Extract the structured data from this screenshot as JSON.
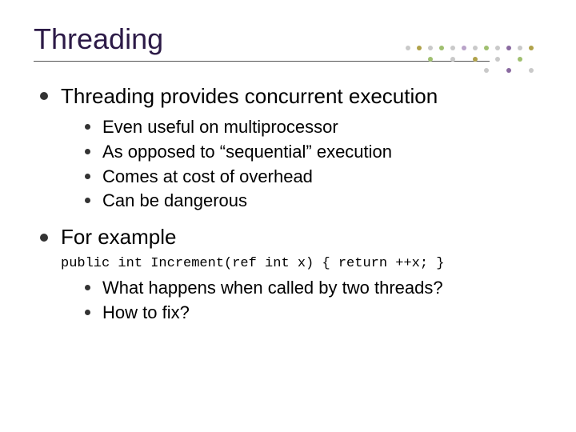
{
  "title": "Threading",
  "bullets": [
    {
      "text": "Threading provides concurrent execution",
      "sub": [
        "Even useful on multiprocessor",
        "As opposed to “sequential” execution",
        "Comes at cost of overhead",
        "Can be dangerous"
      ]
    },
    {
      "text": "For example",
      "code": "public int Increment(ref int x) { return ++x; }",
      "sub": [
        "What happens when called by two threads?",
        "How to fix?"
      ]
    }
  ],
  "decor_colors": {
    "green": "#9fbf6f",
    "olive": "#b0a24a",
    "purple": "#8a6aa0",
    "lilac": "#b9a3c9",
    "grey": "#c9c9c9"
  }
}
